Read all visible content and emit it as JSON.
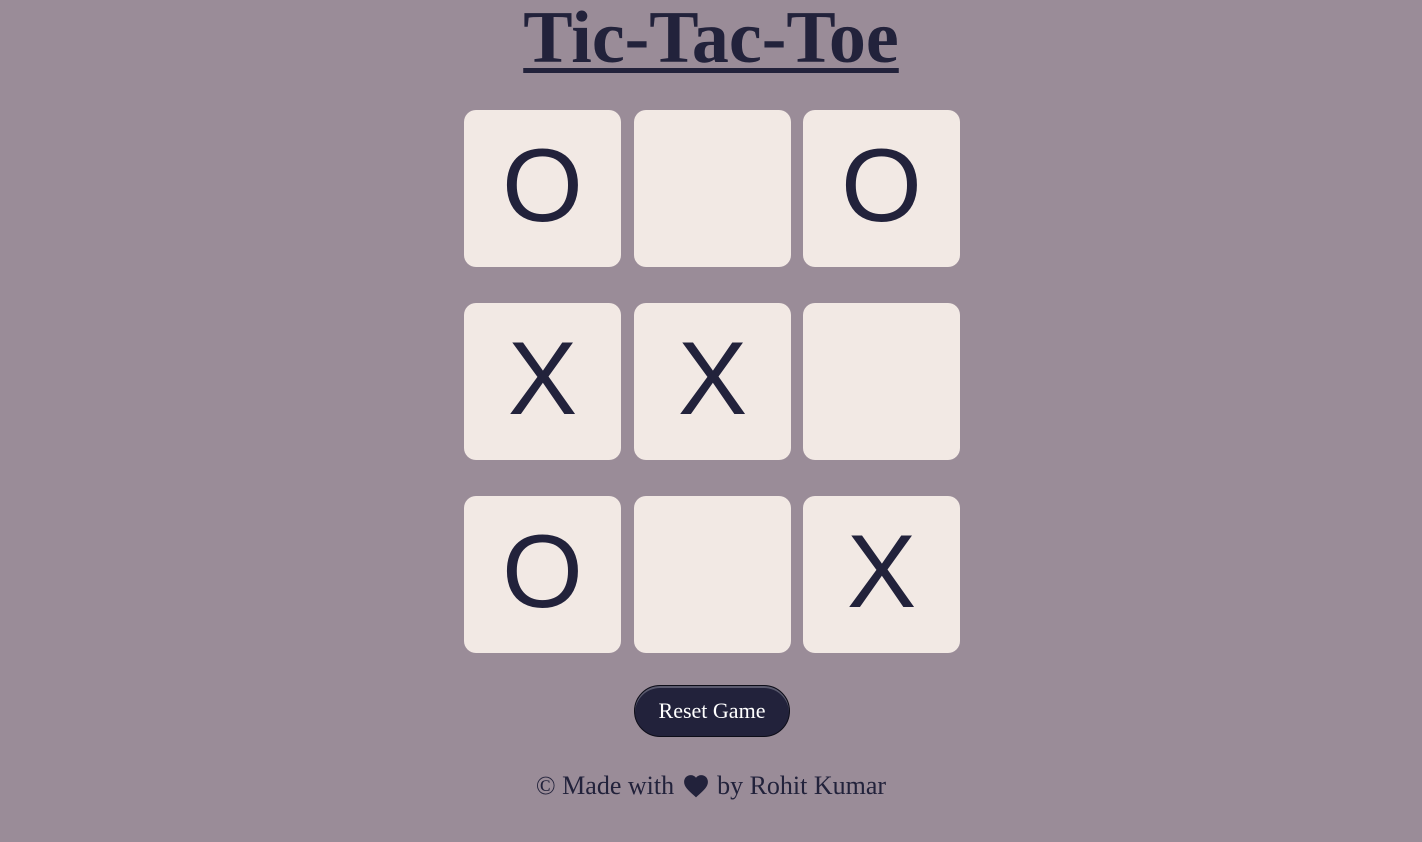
{
  "page": {
    "title": "Tic-Tac-Toe"
  },
  "board": {
    "cells": [
      {
        "mark": "O"
      },
      {
        "mark": ""
      },
      {
        "mark": "O"
      },
      {
        "mark": "X"
      },
      {
        "mark": "X"
      },
      {
        "mark": ""
      },
      {
        "mark": "O"
      },
      {
        "mark": ""
      },
      {
        "mark": "X"
      }
    ]
  },
  "controls": {
    "reset_label": "Reset Game"
  },
  "footer": {
    "prefix": "© Made with",
    "icon": "heart-icon",
    "suffix": "by Rohit Kumar"
  },
  "colors": {
    "background": "#9a8c98",
    "ink": "#22223b",
    "cell": "#f2e9e4",
    "button_text": "#ffffff"
  }
}
